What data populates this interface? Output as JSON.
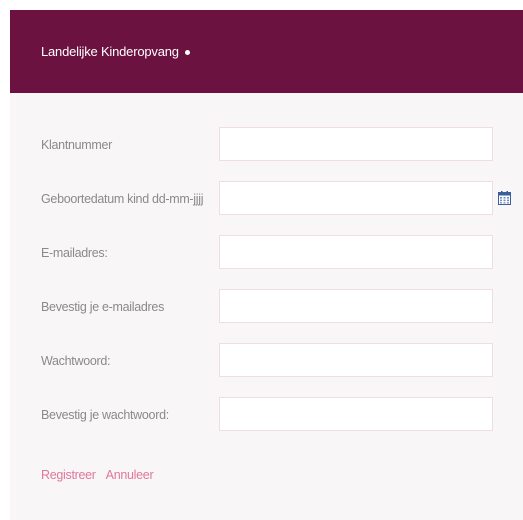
{
  "header": {
    "brand": "Landelijke Kinderopvang"
  },
  "form": {
    "fields": [
      {
        "label": "Klantnummer",
        "value": ""
      },
      {
        "label": "Geboortedatum kind dd-mm-jjjj",
        "value": ""
      },
      {
        "label": "E-mailadres:",
        "value": ""
      },
      {
        "label": "Bevestig je e-mailadres",
        "value": ""
      },
      {
        "label": "Wachtwoord:",
        "value": ""
      },
      {
        "label": "Bevestig je wachtwoord:",
        "value": ""
      }
    ],
    "calendar_icon": "calendar-icon"
  },
  "actions": {
    "register": "Registreer",
    "cancel": "Annuleer"
  },
  "colors": {
    "header_bg": "#6b1240",
    "link": "#e0779f",
    "label": "#8a8a8a",
    "input_border": "#eedde3"
  }
}
